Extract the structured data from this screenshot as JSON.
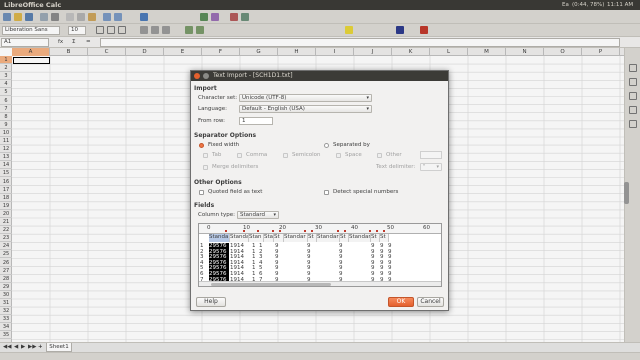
{
  "app": {
    "title": "LibreOffice Calc",
    "indicators": [
      "Ea",
      "(0:44, 78%)",
      "11:11 AM"
    ]
  },
  "toolbar": {
    "font_name": "Liberation Sans",
    "font_size": "10"
  },
  "formula": {
    "name_box": "A1",
    "fx": "fx",
    "sum": "Σ",
    "eq": "="
  },
  "sheet": {
    "columns": [
      "A",
      "B",
      "C",
      "D",
      "E",
      "F",
      "G",
      "H",
      "I",
      "J",
      "K",
      "L",
      "M",
      "N",
      "O",
      "P"
    ],
    "selected_col": "A",
    "rows": [
      "1",
      "2",
      "3",
      "4",
      "5",
      "6",
      "7",
      "8",
      "9",
      "10",
      "11",
      "12",
      "13",
      "14",
      "15",
      "16",
      "17",
      "18",
      "19",
      "20",
      "21",
      "22",
      "23",
      "24",
      "25",
      "26",
      "27",
      "28",
      "29",
      "30",
      "31",
      "32",
      "33",
      "34",
      "35"
    ],
    "tab": "Sheet1",
    "nav": [
      "◀◀",
      "◀",
      "▶",
      "▶▶",
      "+"
    ]
  },
  "dialog": {
    "title": "Text Import - [SCH1D1.txt]",
    "import_label": "Import",
    "charset_label": "Character set:",
    "charset_value": "Unicode (UTF-8)",
    "language_label": "Language:",
    "language_value": "Default - English (USA)",
    "fromrow_label": "From row:",
    "fromrow_value": "1",
    "sep_label": "Separator Options",
    "fixed_width": "Fixed width",
    "separated_by": "Separated by",
    "tab": "Tab",
    "comma": "Comma",
    "semicolon": "Semicolon",
    "space": "Space",
    "other": "Other",
    "merge": "Merge delimiters",
    "text_delim": "Text delimiter:",
    "text_delim_value": "\"",
    "other_opts": "Other Options",
    "quoted": "Quoted field as text",
    "detect": "Detect special numbers",
    "fields": "Fields",
    "coltype_label": "Column type:",
    "coltype_value": "Standard",
    "ruler": [
      "0",
      "10",
      "20",
      "30",
      "40",
      "50",
      "60"
    ],
    "headers": [
      "Standa",
      "Standa",
      "Stan",
      "Stan",
      "St",
      "Standar",
      "St",
      "Standar",
      "St",
      "Standar",
      "St",
      "St"
    ],
    "rows": [
      [
        "1",
        "29576",
        "1914",
        "1",
        "1",
        "9",
        "9",
        "9",
        "9",
        "9",
        "9"
      ],
      [
        "2",
        "29576",
        "1914",
        "1",
        "2",
        "9",
        "9",
        "9",
        "9",
        "9",
        "9"
      ],
      [
        "3",
        "29576",
        "1914",
        "1",
        "3",
        "9",
        "9",
        "9",
        "9",
        "9",
        "9"
      ],
      [
        "4",
        "29576",
        "1914",
        "1",
        "4",
        "9",
        "9",
        "9",
        "9",
        "9",
        "9"
      ],
      [
        "5",
        "29576",
        "1914",
        "1",
        "5",
        "9",
        "9",
        "9",
        "9",
        "9",
        "9"
      ],
      [
        "6",
        "29576",
        "1914",
        "1",
        "6",
        "9",
        "9",
        "9",
        "9",
        "9",
        "9"
      ],
      [
        "7",
        "29576",
        "1914",
        "1",
        "7",
        "9",
        "9",
        "9",
        "9",
        "9",
        "9"
      ]
    ],
    "help": "Help",
    "ok": "OK",
    "cancel": "Cancel"
  },
  "colors": {
    "accent": "#e4602e",
    "titlebar": "#3c3b37",
    "selected_col_header": "#f4b183"
  }
}
